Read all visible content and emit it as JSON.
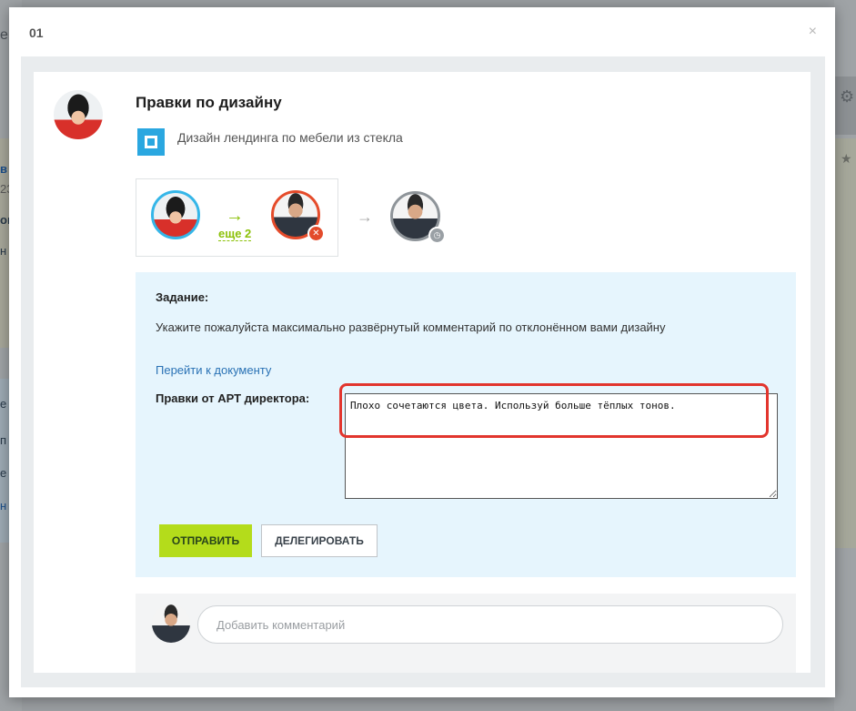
{
  "dialog": {
    "title": "01",
    "close_glyph": "×"
  },
  "background": {
    "left_letters": [
      "е",
      "в",
      "23",
      "ов",
      "н",
      "е",
      "п",
      "е",
      "н"
    ],
    "right_icons": [
      "gear-icon",
      "star-icon"
    ]
  },
  "task": {
    "title": "Правки по дизайну",
    "project_name": "Дизайн лендинга по мебели из стекла"
  },
  "flow": {
    "more_label": "еще 2",
    "arrow_glyph": "→",
    "next_arrow_glyph": "→",
    "reject_glyph": "✕",
    "clock_glyph": "◷"
  },
  "assignment": {
    "label": "Задание:",
    "text": "Укажите пожалуйста максимально развёрнутый комментарий по отклонённом вами дизайну",
    "doc_link": "Перейти к документу",
    "field_label": "Правки от АРТ директора:",
    "comment_value": "Плохо сочетаются цвета. Используй больше тёплых тонов.",
    "send_label": "ОТПРАВИТЬ",
    "delegate_label": "ДЕЛЕГИРОВАТЬ"
  },
  "comment": {
    "placeholder": "Добавить комментарий"
  },
  "colors": {
    "accent_green": "#b4dc1b",
    "link_blue": "#2a72b5",
    "reject_red": "#e34b2b",
    "highlight_red": "#e2352d",
    "panel_blue": "#e6f5fd"
  }
}
